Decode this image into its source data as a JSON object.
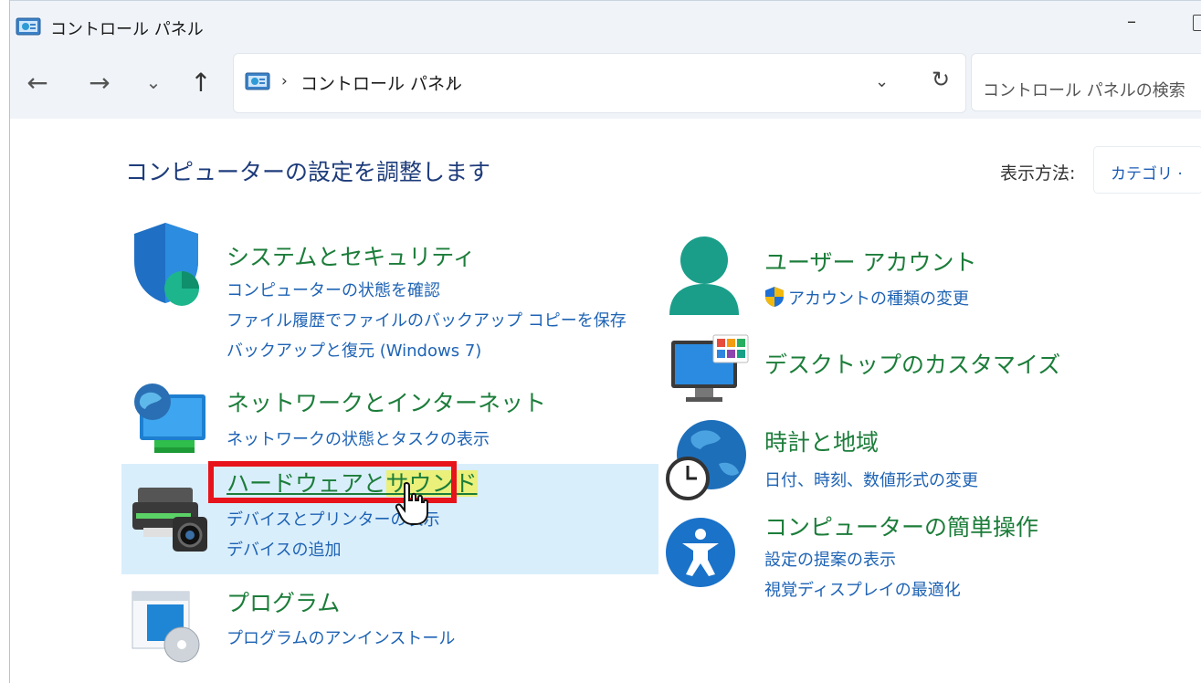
{
  "window": {
    "title": "コントロール パネル"
  },
  "nav": {
    "back": "←",
    "forward": "→",
    "recent": "⌄",
    "up": "↑"
  },
  "address": {
    "sep": "›",
    "path": "コントロール パネル",
    "dropdown": "⌄",
    "refresh": "↻"
  },
  "search": {
    "placeholder": "コントロール パネルの検索"
  },
  "heading": "コンピューターの設定を調整します",
  "view": {
    "label": "表示方法:",
    "value": "カテゴリ ·"
  },
  "left_categories": [
    {
      "title": "システムとセキュリティ",
      "links": [
        "コンピューターの状態を確認",
        "ファイル履歴でファイルのバックアップ コピーを保存",
        "バックアップと復元 (Windows 7)"
      ]
    },
    {
      "title": "ネットワークとインターネット",
      "links": [
        "ネットワークの状態とタスクの表示"
      ]
    },
    {
      "title_part1": "ハードウェアと",
      "title_part2": "サウンド",
      "links": [
        "デバイスとプリンターの表示",
        "デバイスの追加"
      ]
    },
    {
      "title": "プログラム",
      "links": [
        "プログラムのアンインストール"
      ]
    }
  ],
  "right_categories": [
    {
      "title": "ユーザー アカウント",
      "links": [
        "アカウントの種類の変更"
      ]
    },
    {
      "title": "デスクトップのカスタマイズ",
      "links": []
    },
    {
      "title": "時計と地域",
      "links": [
        "日付、時刻、数値形式の変更"
      ]
    },
    {
      "title": "コンピューターの簡単操作",
      "links": [
        "設定の提案の表示",
        "視覚ディスプレイの最適化"
      ]
    }
  ],
  "colors": {
    "category_title": "#1c7d3a",
    "link": "#1e63b4",
    "heading": "#1e3c7b",
    "hover": "#d9eefb",
    "highlight_border": "#e8141b"
  }
}
